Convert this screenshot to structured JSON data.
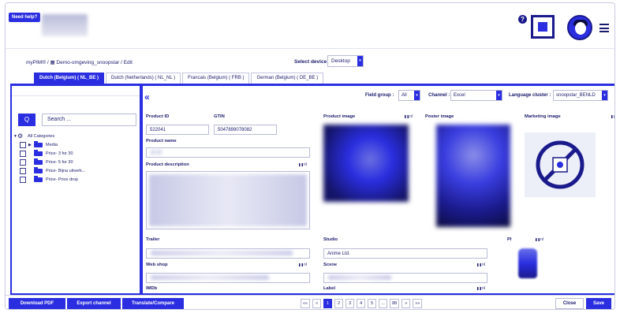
{
  "header": {
    "need_help": "Need help?",
    "help_icon": "?",
    "icons": [
      "help-icon",
      "fullscreen-icon",
      "avatar",
      "hamburger-menu-icon"
    ]
  },
  "breadcrumb": {
    "root": "myPIM®",
    "sep1": "/",
    "item": "Demo-omgeving_snoopstar",
    "sep2": "/",
    "current": "Edit"
  },
  "device": {
    "label": "Select device :",
    "value": "Desktop"
  },
  "tabs": [
    {
      "label": "Dutch (Belgium) ( NL_BE )",
      "active": true
    },
    {
      "label": "Dutch (Netherlands) ( NL_NL )",
      "active": false
    },
    {
      "label": "Francais (Belgium) ( FRB )",
      "active": false
    },
    {
      "label": "German (Belgium) ( DE_BE )",
      "active": false
    }
  ],
  "sidebar": {
    "search_button": "Q",
    "search_placeholder": "Search ...",
    "tree": {
      "root_label": "All Categories",
      "items": [
        "Media",
        "Price- 3 for 30",
        "Price- 5 for 30",
        "Price- Bijna uitverk...",
        "Price- Price drop"
      ]
    }
  },
  "main": {
    "collapse_icon": "«",
    "filters": {
      "field_group_label": "Field group :",
      "field_group_value": "All",
      "channel_label": "Channel :",
      "channel_value": "Excel",
      "language_cluster_label": "Language cluster :",
      "language_cluster_value": "snoopstar_BENLD"
    },
    "fields": {
      "product_id_label": "Product ID",
      "product_id_value": "522041",
      "gtin_label": "GTIN",
      "gtin_value": "5047899078082",
      "product_name_label": "Product name",
      "product_description_label": "Product description",
      "product_image_label": "Product image",
      "poster_image_label": "Poster image",
      "marketing_image_label": "Marketing image",
      "trailer_label": "Trailer",
      "studio_label": "Studio",
      "studio_value": "Anime Ltd.",
      "pi_label": "PI",
      "web_shop_label": "Web shop",
      "scene_label": "Scene",
      "imdb_label": "IMDb",
      "label_label": "Label",
      "lang_nl": "nl"
    }
  },
  "bottom": {
    "download_pdf": "Download PDF",
    "export_channel": "Export channel",
    "translate_compare": "Translate/Compare",
    "pager": [
      "««",
      "«",
      "1",
      "2",
      "3",
      "4",
      "5",
      "...",
      "88",
      "»",
      "»»"
    ],
    "active_page": "1",
    "close": "Close",
    "save": "Save"
  },
  "colors": {
    "primary": "#2a2ee0",
    "dark": "#1a1a6e"
  }
}
